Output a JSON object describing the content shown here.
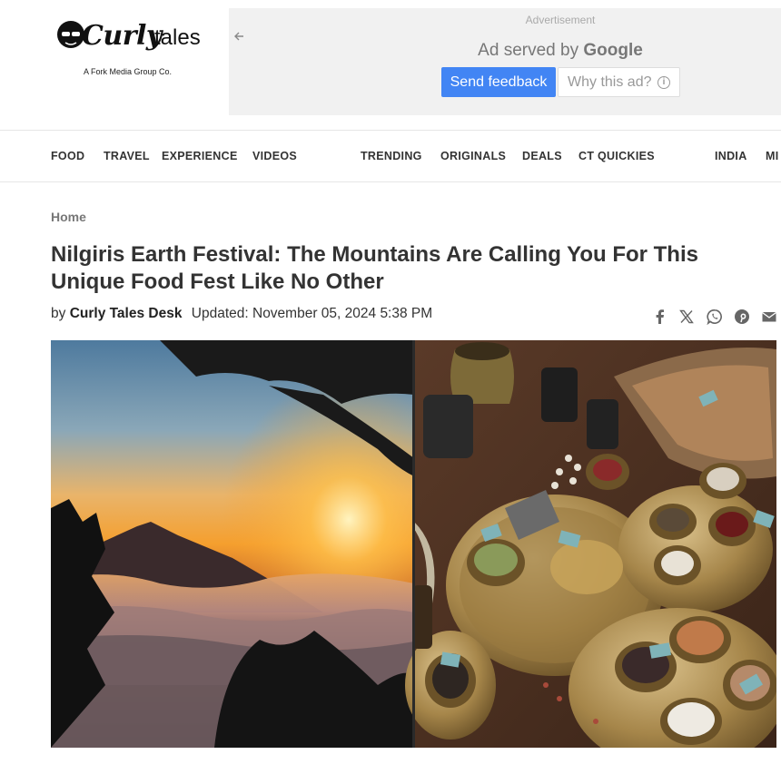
{
  "brand": {
    "logo_word": "Curly",
    "logo_tales": "tales",
    "tagline": "A Fork Media Group Co."
  },
  "ad": {
    "label": "Advertisement",
    "served_by": "Ad served by",
    "google": "Google",
    "feedback_button": "Send feedback",
    "why_button": "Why this ad?"
  },
  "nav": {
    "items": [
      "FOOD",
      "TRAVEL",
      "EXPERIENCE",
      "VIDEOS",
      "TRENDING",
      "ORIGINALS",
      "DEALS",
      "CT QUICKIES",
      "INDIA",
      "MI"
    ]
  },
  "breadcrumb": "Home",
  "article": {
    "title": "Nilgiris Earth Festival: The Mountains Are Calling You For This Unique Food Fest Like No Other",
    "by": "by",
    "author": "Curly Tales Desk",
    "updated": "Updated: November 05, 2024 5:38 PM"
  },
  "share_icons": [
    "facebook-icon",
    "x-icon",
    "whatsapp-icon",
    "pinterest-icon",
    "mail-icon"
  ],
  "colors": {
    "feedback_blue": "#4285f4",
    "ad_bg": "#f1f1f1",
    "title_text": "#333333"
  }
}
